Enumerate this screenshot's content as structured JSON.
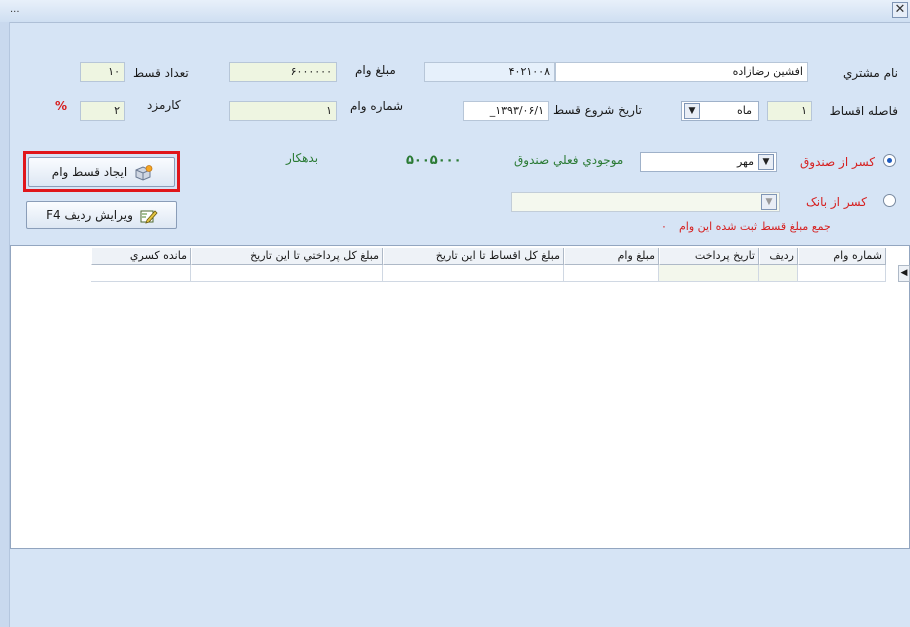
{
  "window": {
    "title_dots": "...",
    "close_glyph": "✕"
  },
  "form": {
    "customer_name_label": "نام مشتري",
    "customer_name_value": "افشين رضازاده",
    "account_code_value": "۴۰۲۱۰۰۸",
    "loan_amount_label": "مبلغ وام",
    "loan_amount_value": "۶۰۰۰۰۰۰",
    "installment_count_label": "تعداد قسط",
    "installment_count_value": "۱۰",
    "installment_interval_label": "فاصله اقساط",
    "installment_interval_value": "۱",
    "interval_unit_value": "ماه",
    "start_date_label": "تاريخ شروع قسط",
    "start_date_value": "_۱۳۹۳/۰۶/۱",
    "loan_number_label": "شماره وام",
    "loan_number_value": "۱",
    "fee_label": "کارمزد",
    "fee_value": "۲",
    "percent_sign": "%",
    "fund_deduct_label": "کسر از صندوق",
    "fund_name_value": "مهر",
    "fund_balance_label": "موجودي فعلي صندوق",
    "fund_balance_value": "۵۰۰۵۰۰۰",
    "debtor_label": "بدهکار",
    "bank_deduct_label": "کسر از بانک",
    "bank_value": "",
    "total_installments_label": "جمع مبلغ قسط ثبت شده اين وام",
    "total_installments_value": "۰"
  },
  "buttons": {
    "create_installment": "ايجاد قسط وام",
    "edit_row": "ويرايش رديف F4"
  },
  "grid": {
    "columns": [
      "شماره وام",
      "رديف",
      "تاريخ پرداخت",
      "مبلغ وام",
      "مبلغ کل اقساط تا اين تاريخ",
      "مبلغ کل پرداختي تا اين تاريخ",
      "مانده کسري"
    ]
  },
  "colors": {
    "accent_red": "#e0161b",
    "label_red": "#d62020",
    "label_green": "#2a7a34"
  }
}
